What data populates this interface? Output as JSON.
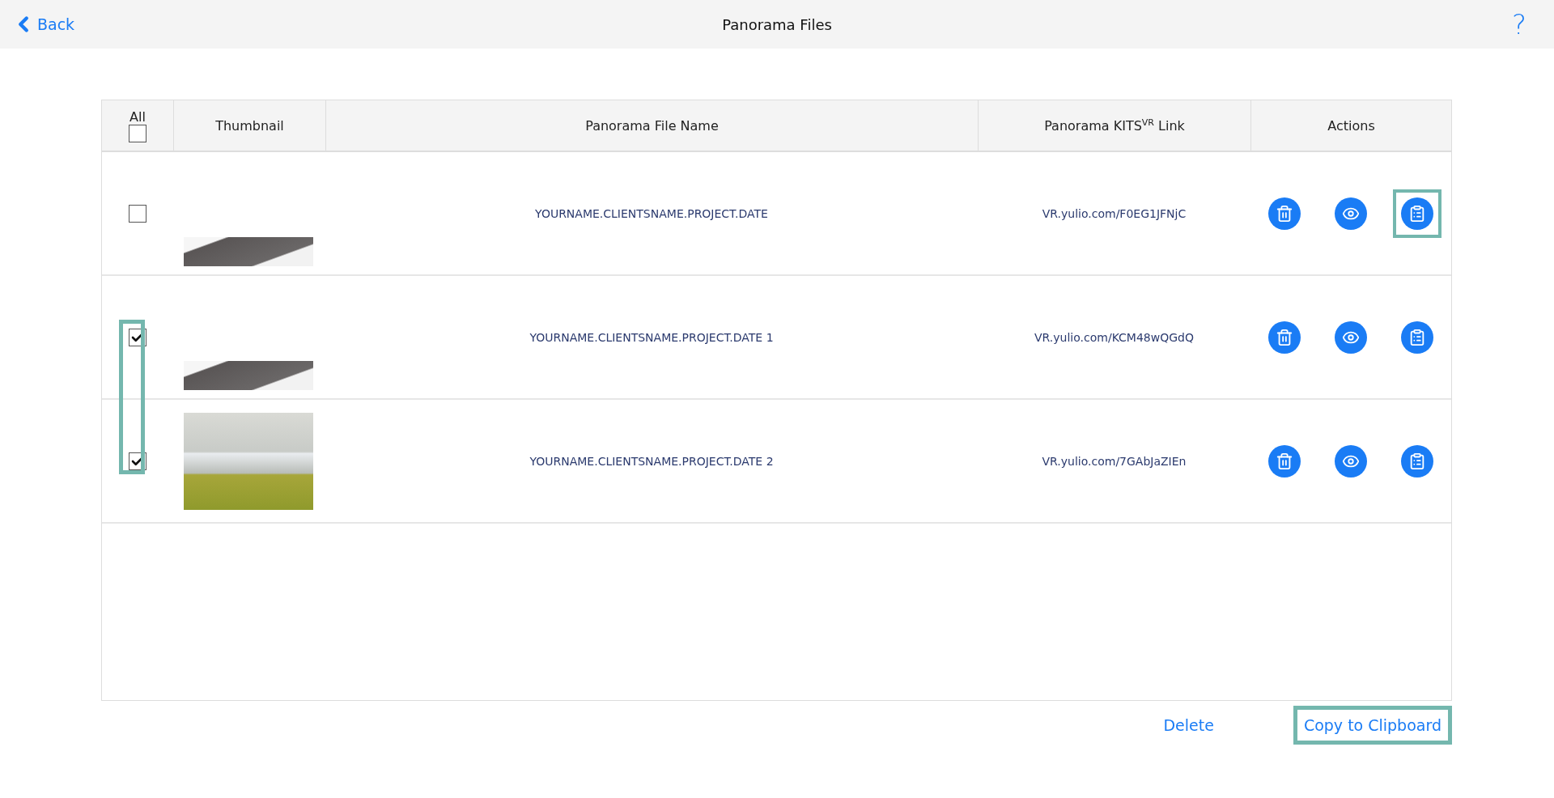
{
  "header": {
    "back": "Back",
    "title": "Panorama Files",
    "help": "?"
  },
  "table": {
    "columns": [
      {
        "label": "All",
        "kind": "select_all",
        "checked": false
      },
      {
        "label": "Thumbnail",
        "kind": "text"
      },
      {
        "label": "Panorama File Name",
        "kind": "text"
      },
      {
        "label": "Panorama KITS$^{VR}$ Link",
        "kind": "text"
      },
      {
        "label": "Actions",
        "kind": "text"
      }
    ],
    "rows": [
      {
        "checked": false,
        "checkbox_highlighted": false,
        "thumbnail": {
          "kind": "partial"
        },
        "file_name": "YOURNAME.CLIENTSNAME.PROJECT.DATE",
        "link": "VR.yulio.com/F0EG1JFNjC",
        "copy_highlighted": true
      },
      {
        "checked": true,
        "checkbox_highlighted": true,
        "thumbnail": {
          "kind": "partial"
        },
        "file_name": "YOURNAME.CLIENTSNAME.PROJECT.DATE 1",
        "link": "VR.yulio.com/KCM48wQGdQ",
        "copy_highlighted": false
      },
      {
        "checked": true,
        "checkbox_highlighted": true,
        "thumbnail": {
          "kind": "full"
        },
        "file_name": "YOURNAME.CLIENTSNAME.PROJECT.DATE 2",
        "link": "VR.yulio.com/7GAbJaZIEn",
        "copy_highlighted": false
      }
    ]
  },
  "footer": {
    "buttons": [
      {
        "label": "Delete",
        "highlighted": false
      },
      {
        "label": "Copy to Clipboard",
        "highlighted": true
      }
    ]
  }
}
